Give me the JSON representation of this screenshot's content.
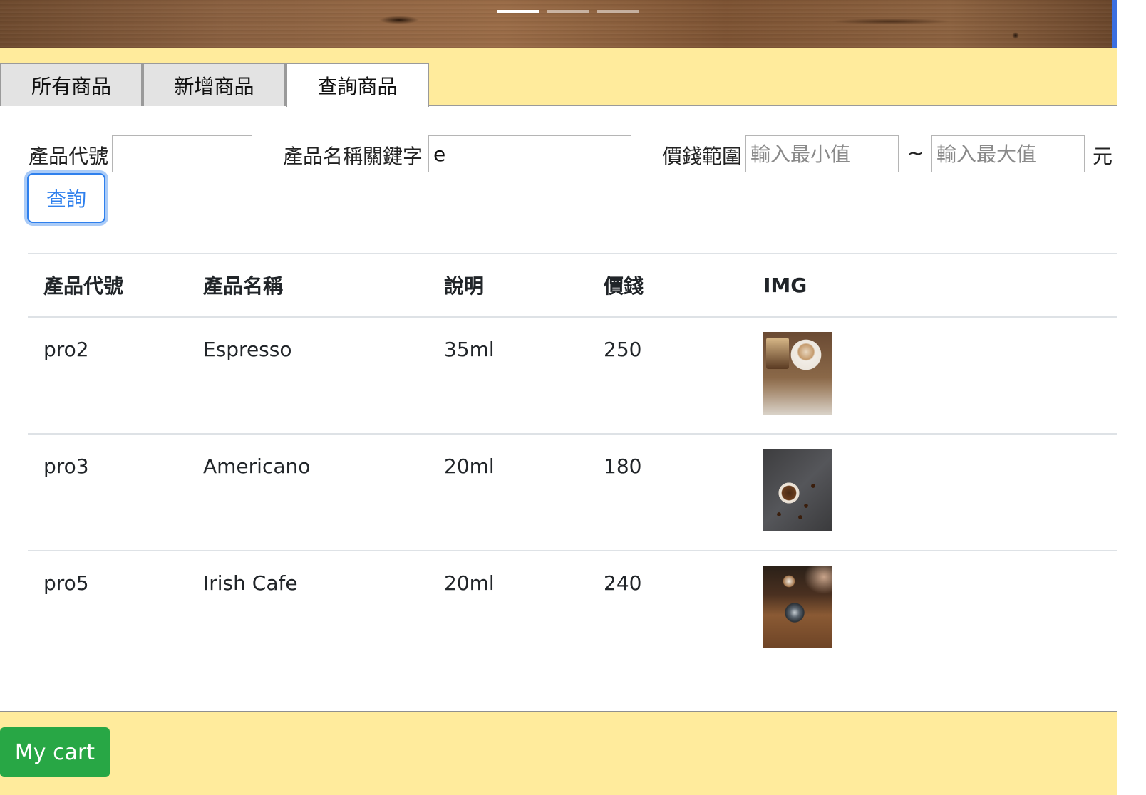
{
  "carousel": {
    "indicators": 3,
    "active_index": 0
  },
  "tabs": [
    {
      "label": "所有商品",
      "active": false
    },
    {
      "label": "新增商品",
      "active": false
    },
    {
      "label": "查詢商品",
      "active": true
    }
  ],
  "search": {
    "code_label": "產品代號",
    "code_value": "",
    "name_label": "產品名稱關鍵字",
    "name_value": "e",
    "price_label": "價錢範圍",
    "min_placeholder": "輸入最小值",
    "max_placeholder": "輸入最大值",
    "range_separator": "~",
    "currency": "元",
    "submit_label": "查詢"
  },
  "table": {
    "headers": [
      "產品代號",
      "產品名稱",
      "說明",
      "價錢",
      "IMG"
    ],
    "rows": [
      {
        "code": "pro2",
        "name": "Espresso",
        "desc": "35ml",
        "price": "250",
        "img": "latte-with-cake-photo"
      },
      {
        "code": "pro3",
        "name": "Americano",
        "desc": "20ml",
        "price": "180",
        "img": "coffee-cup-with-beans-photo"
      },
      {
        "code": "pro5",
        "name": "Irish Cafe",
        "desc": "20ml",
        "price": "240",
        "img": "coffee-cups-on-wood-photo"
      }
    ]
  },
  "footer": {
    "cart_label": "My cart"
  },
  "colors": {
    "band": "#ffeb9c",
    "primary": "#2f80ed",
    "cart": "#28a745"
  }
}
